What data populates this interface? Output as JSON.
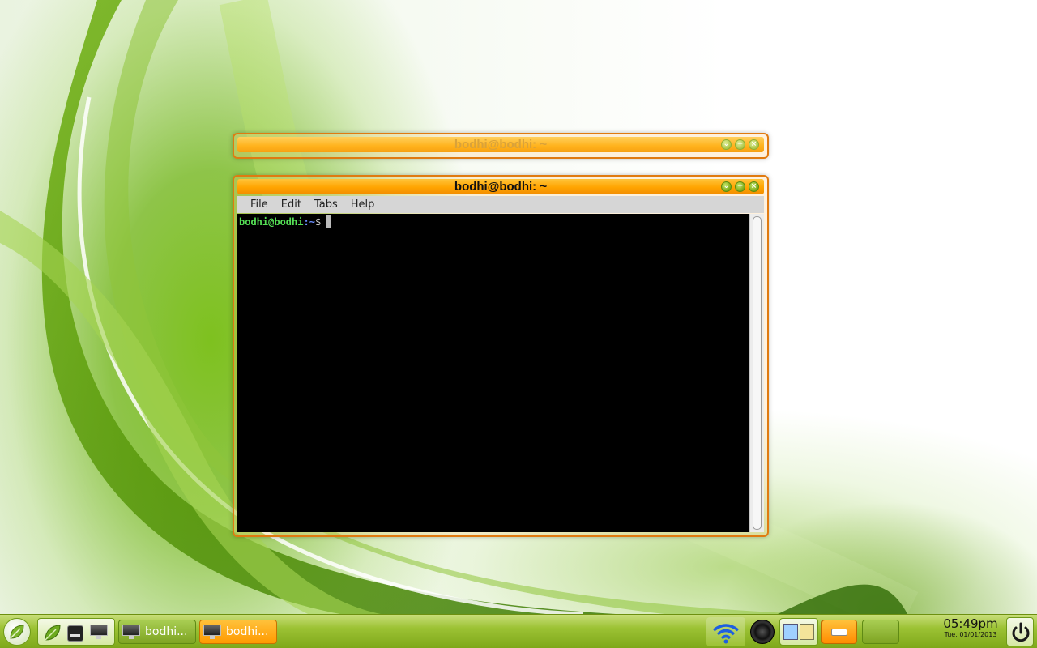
{
  "windows": [
    {
      "title": "bodhi@bodhi: ~",
      "state": "inactive"
    },
    {
      "title": "bodhi@bodhi: ~",
      "state": "active",
      "menu": [
        "File",
        "Edit",
        "Tabs",
        "Help"
      ],
      "prompt": {
        "user": "bodhi@bodhi",
        "path": ":~",
        "dollar": "$"
      }
    }
  ],
  "window_buttons": {
    "minimize": "⌄",
    "maximize": "+",
    "close": "×"
  },
  "taskbar": {
    "launchers": [
      "bodhi-leaf-icon",
      "terminal-icon",
      "desktop-icon"
    ],
    "tasks": [
      {
        "label": "bodhi...",
        "active": false
      },
      {
        "label": "bodhi...",
        "active": true
      }
    ],
    "tray": [
      "wifi-icon",
      "speaker-icon",
      "pager-icon",
      "drive-icon",
      "workspace-icon"
    ],
    "clock": {
      "time": "05:49pm",
      "date": "Tue, 01/01/2013"
    }
  },
  "colors": {
    "accent": "#ff9a00",
    "taskbar": "#9cc234",
    "prompt_user": "#55e055",
    "prompt_path": "#6a8dff"
  }
}
